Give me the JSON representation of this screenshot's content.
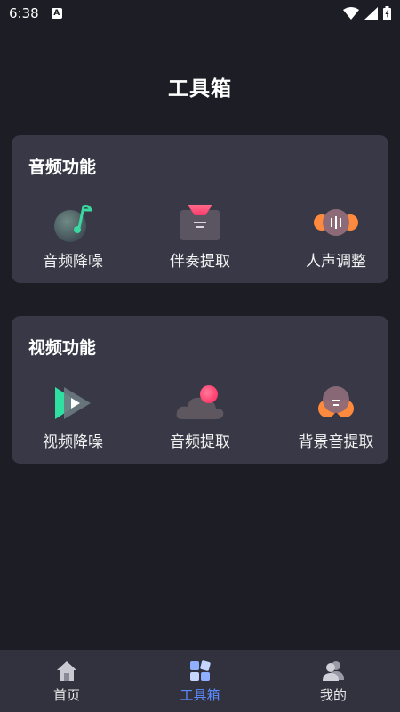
{
  "status_bar": {
    "time": "6:38",
    "badge": "A"
  },
  "page": {
    "title": "工具箱"
  },
  "audio_section": {
    "title": "音频功能",
    "tools": [
      {
        "label": "音频降噪",
        "icon": "music-note-icon"
      },
      {
        "label": "伴奏提取",
        "icon": "tray-extract-icon"
      },
      {
        "label": "人声调整",
        "icon": "voice-adjust-icon"
      }
    ]
  },
  "video_section": {
    "title": "视频功能",
    "tools": [
      {
        "label": "视频降噪",
        "icon": "video-play-icon"
      },
      {
        "label": "音频提取",
        "icon": "cloud-icon"
      },
      {
        "label": "背景音提取",
        "icon": "background-sound-icon"
      }
    ]
  },
  "bottom_nav": {
    "items": [
      {
        "label": "首页",
        "icon": "home-icon"
      },
      {
        "label": "工具箱",
        "icon": "toolbox-icon",
        "active": true
      },
      {
        "label": "我的",
        "icon": "user-icon"
      }
    ],
    "active_color": "#5b8cff"
  }
}
